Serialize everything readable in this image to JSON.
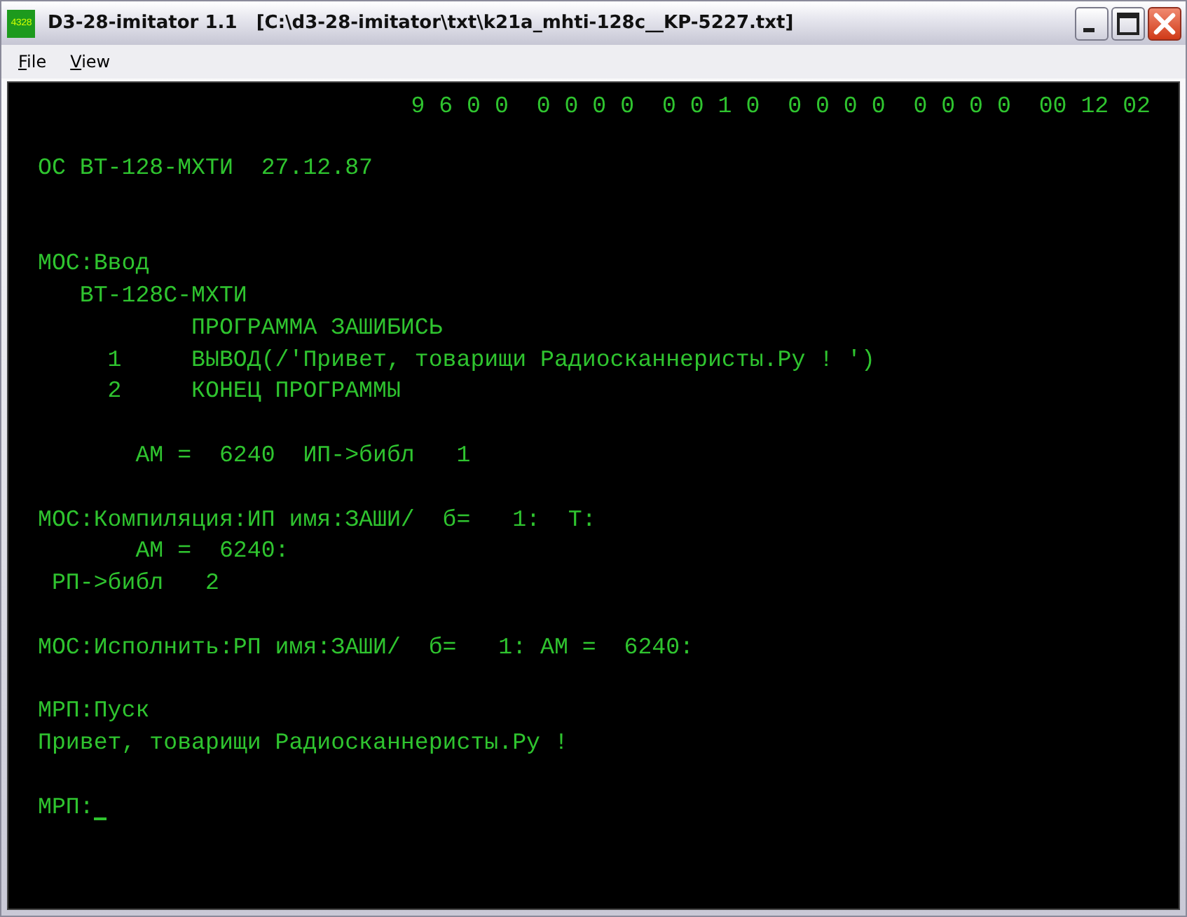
{
  "window": {
    "icon_text": "4328",
    "title": "D3-28-imitator 1.1   [C:\\d3-28-imitator\\txt\\k21a_mhti-128c__KP-5227.txt]"
  },
  "menu": [
    {
      "label": "File",
      "hotkey_underlined": true
    },
    {
      "label": "View",
      "hotkey_underlined": true
    }
  ],
  "terminal": {
    "status_line": "9 6 0 0  0 0 0 0  0 0 1 0  0 0 0 0  0 0 0 0  00 12 02",
    "lines": [
      {
        "kind": "text",
        "text": "ОС ВТ-128-МХТИ  27.12.87"
      },
      {
        "kind": "blank"
      },
      {
        "kind": "blank"
      },
      {
        "kind": "text",
        "text": "МОС:Ввод"
      },
      {
        "kind": "text",
        "text": "   ВТ-128С-МХТИ"
      },
      {
        "kind": "text",
        "text": "           ПРОГРАММА ЗАШИБИСЬ"
      },
      {
        "kind": "text",
        "text": "     1     ВЫВОД(/'Привет, товарищи Радиосканнеристы.Ру ! ')"
      },
      {
        "kind": "text",
        "text": "     2     КОНЕЦ ПРОГРАММЫ"
      },
      {
        "kind": "blank"
      },
      {
        "kind": "text",
        "text": "       АМ =  6240  ИП->библ   1"
      },
      {
        "kind": "blank"
      },
      {
        "kind": "text",
        "text": "МОС:Компиляция:ИП имя:ЗАШИ/  б=   1:  Т:"
      },
      {
        "kind": "text",
        "text": "       АМ =  6240:"
      },
      {
        "kind": "text",
        "text": " РП->библ   2"
      },
      {
        "kind": "blank"
      },
      {
        "kind": "text",
        "text": "МОС:Исполнить:РП имя:ЗАШИ/  б=   1: АМ =  6240:"
      },
      {
        "kind": "blank"
      },
      {
        "kind": "text",
        "text": "МРП:Пуск"
      },
      {
        "kind": "text",
        "text": "Привет, товарищи Радиосканнеристы.Ру !"
      },
      {
        "kind": "blank"
      },
      {
        "kind": "prompt",
        "text": "МРП:",
        "cursor": true
      }
    ]
  }
}
